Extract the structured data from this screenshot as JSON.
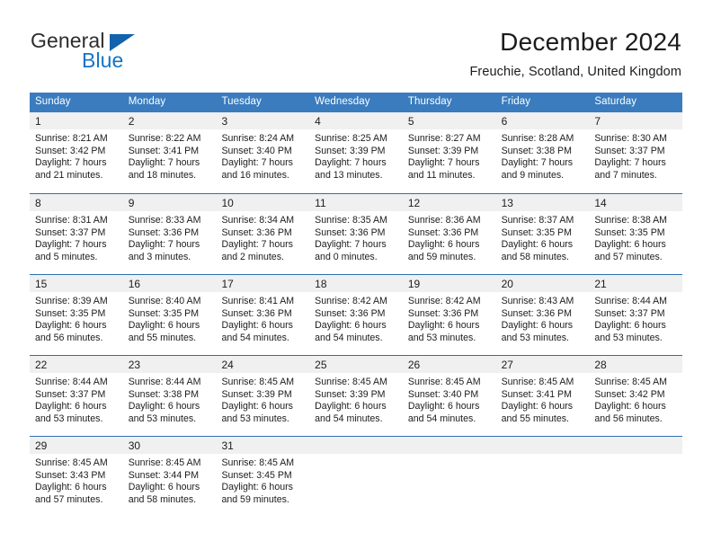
{
  "brand": {
    "name_top": "General",
    "name_bottom": "Blue",
    "triangle_color": "#1263ad",
    "blue_color": "#1574c4"
  },
  "header": {
    "title": "December 2024",
    "subtitle": "Freuchie, Scotland, United Kingdom"
  },
  "theme": {
    "header_row_bg": "#3a7cbe",
    "week_divider": "#2f6fad",
    "day_number_band": "#f0f0f0",
    "text": "#1c1c1c"
  },
  "calendar": {
    "weekday_headers": [
      "Sunday",
      "Monday",
      "Tuesday",
      "Wednesday",
      "Thursday",
      "Friday",
      "Saturday"
    ],
    "weeks": [
      [
        {
          "day": "1",
          "sunrise": "Sunrise: 8:21 AM",
          "sunset": "Sunset: 3:42 PM",
          "daylight_line1": "Daylight: 7 hours",
          "daylight_line2": "and 21 minutes."
        },
        {
          "day": "2",
          "sunrise": "Sunrise: 8:22 AM",
          "sunset": "Sunset: 3:41 PM",
          "daylight_line1": "Daylight: 7 hours",
          "daylight_line2": "and 18 minutes."
        },
        {
          "day": "3",
          "sunrise": "Sunrise: 8:24 AM",
          "sunset": "Sunset: 3:40 PM",
          "daylight_line1": "Daylight: 7 hours",
          "daylight_line2": "and 16 minutes."
        },
        {
          "day": "4",
          "sunrise": "Sunrise: 8:25 AM",
          "sunset": "Sunset: 3:39 PM",
          "daylight_line1": "Daylight: 7 hours",
          "daylight_line2": "and 13 minutes."
        },
        {
          "day": "5",
          "sunrise": "Sunrise: 8:27 AM",
          "sunset": "Sunset: 3:39 PM",
          "daylight_line1": "Daylight: 7 hours",
          "daylight_line2": "and 11 minutes."
        },
        {
          "day": "6",
          "sunrise": "Sunrise: 8:28 AM",
          "sunset": "Sunset: 3:38 PM",
          "daylight_line1": "Daylight: 7 hours",
          "daylight_line2": "and 9 minutes."
        },
        {
          "day": "7",
          "sunrise": "Sunrise: 8:30 AM",
          "sunset": "Sunset: 3:37 PM",
          "daylight_line1": "Daylight: 7 hours",
          "daylight_line2": "and 7 minutes."
        }
      ],
      [
        {
          "day": "8",
          "sunrise": "Sunrise: 8:31 AM",
          "sunset": "Sunset: 3:37 PM",
          "daylight_line1": "Daylight: 7 hours",
          "daylight_line2": "and 5 minutes."
        },
        {
          "day": "9",
          "sunrise": "Sunrise: 8:33 AM",
          "sunset": "Sunset: 3:36 PM",
          "daylight_line1": "Daylight: 7 hours",
          "daylight_line2": "and 3 minutes."
        },
        {
          "day": "10",
          "sunrise": "Sunrise: 8:34 AM",
          "sunset": "Sunset: 3:36 PM",
          "daylight_line1": "Daylight: 7 hours",
          "daylight_line2": "and 2 minutes."
        },
        {
          "day": "11",
          "sunrise": "Sunrise: 8:35 AM",
          "sunset": "Sunset: 3:36 PM",
          "daylight_line1": "Daylight: 7 hours",
          "daylight_line2": "and 0 minutes."
        },
        {
          "day": "12",
          "sunrise": "Sunrise: 8:36 AM",
          "sunset": "Sunset: 3:36 PM",
          "daylight_line1": "Daylight: 6 hours",
          "daylight_line2": "and 59 minutes."
        },
        {
          "day": "13",
          "sunrise": "Sunrise: 8:37 AM",
          "sunset": "Sunset: 3:35 PM",
          "daylight_line1": "Daylight: 6 hours",
          "daylight_line2": "and 58 minutes."
        },
        {
          "day": "14",
          "sunrise": "Sunrise: 8:38 AM",
          "sunset": "Sunset: 3:35 PM",
          "daylight_line1": "Daylight: 6 hours",
          "daylight_line2": "and 57 minutes."
        }
      ],
      [
        {
          "day": "15",
          "sunrise": "Sunrise: 8:39 AM",
          "sunset": "Sunset: 3:35 PM",
          "daylight_line1": "Daylight: 6 hours",
          "daylight_line2": "and 56 minutes."
        },
        {
          "day": "16",
          "sunrise": "Sunrise: 8:40 AM",
          "sunset": "Sunset: 3:35 PM",
          "daylight_line1": "Daylight: 6 hours",
          "daylight_line2": "and 55 minutes."
        },
        {
          "day": "17",
          "sunrise": "Sunrise: 8:41 AM",
          "sunset": "Sunset: 3:36 PM",
          "daylight_line1": "Daylight: 6 hours",
          "daylight_line2": "and 54 minutes."
        },
        {
          "day": "18",
          "sunrise": "Sunrise: 8:42 AM",
          "sunset": "Sunset: 3:36 PM",
          "daylight_line1": "Daylight: 6 hours",
          "daylight_line2": "and 54 minutes."
        },
        {
          "day": "19",
          "sunrise": "Sunrise: 8:42 AM",
          "sunset": "Sunset: 3:36 PM",
          "daylight_line1": "Daylight: 6 hours",
          "daylight_line2": "and 53 minutes."
        },
        {
          "day": "20",
          "sunrise": "Sunrise: 8:43 AM",
          "sunset": "Sunset: 3:36 PM",
          "daylight_line1": "Daylight: 6 hours",
          "daylight_line2": "and 53 minutes."
        },
        {
          "day": "21",
          "sunrise": "Sunrise: 8:44 AM",
          "sunset": "Sunset: 3:37 PM",
          "daylight_line1": "Daylight: 6 hours",
          "daylight_line2": "and 53 minutes."
        }
      ],
      [
        {
          "day": "22",
          "sunrise": "Sunrise: 8:44 AM",
          "sunset": "Sunset: 3:37 PM",
          "daylight_line1": "Daylight: 6 hours",
          "daylight_line2": "and 53 minutes."
        },
        {
          "day": "23",
          "sunrise": "Sunrise: 8:44 AM",
          "sunset": "Sunset: 3:38 PM",
          "daylight_line1": "Daylight: 6 hours",
          "daylight_line2": "and 53 minutes."
        },
        {
          "day": "24",
          "sunrise": "Sunrise: 8:45 AM",
          "sunset": "Sunset: 3:39 PM",
          "daylight_line1": "Daylight: 6 hours",
          "daylight_line2": "and 53 minutes."
        },
        {
          "day": "25",
          "sunrise": "Sunrise: 8:45 AM",
          "sunset": "Sunset: 3:39 PM",
          "daylight_line1": "Daylight: 6 hours",
          "daylight_line2": "and 54 minutes."
        },
        {
          "day": "26",
          "sunrise": "Sunrise: 8:45 AM",
          "sunset": "Sunset: 3:40 PM",
          "daylight_line1": "Daylight: 6 hours",
          "daylight_line2": "and 54 minutes."
        },
        {
          "day": "27",
          "sunrise": "Sunrise: 8:45 AM",
          "sunset": "Sunset: 3:41 PM",
          "daylight_line1": "Daylight: 6 hours",
          "daylight_line2": "and 55 minutes."
        },
        {
          "day": "28",
          "sunrise": "Sunrise: 8:45 AM",
          "sunset": "Sunset: 3:42 PM",
          "daylight_line1": "Daylight: 6 hours",
          "daylight_line2": "and 56 minutes."
        }
      ],
      [
        {
          "day": "29",
          "sunrise": "Sunrise: 8:45 AM",
          "sunset": "Sunset: 3:43 PM",
          "daylight_line1": "Daylight: 6 hours",
          "daylight_line2": "and 57 minutes."
        },
        {
          "day": "30",
          "sunrise": "Sunrise: 8:45 AM",
          "sunset": "Sunset: 3:44 PM",
          "daylight_line1": "Daylight: 6 hours",
          "daylight_line2": "and 58 minutes."
        },
        {
          "day": "31",
          "sunrise": "Sunrise: 8:45 AM",
          "sunset": "Sunset: 3:45 PM",
          "daylight_line1": "Daylight: 6 hours",
          "daylight_line2": "and 59 minutes."
        },
        {
          "day": "",
          "sunrise": "",
          "sunset": "",
          "daylight_line1": "",
          "daylight_line2": ""
        },
        {
          "day": "",
          "sunrise": "",
          "sunset": "",
          "daylight_line1": "",
          "daylight_line2": ""
        },
        {
          "day": "",
          "sunrise": "",
          "sunset": "",
          "daylight_line1": "",
          "daylight_line2": ""
        },
        {
          "day": "",
          "sunrise": "",
          "sunset": "",
          "daylight_line1": "",
          "daylight_line2": ""
        }
      ]
    ]
  }
}
